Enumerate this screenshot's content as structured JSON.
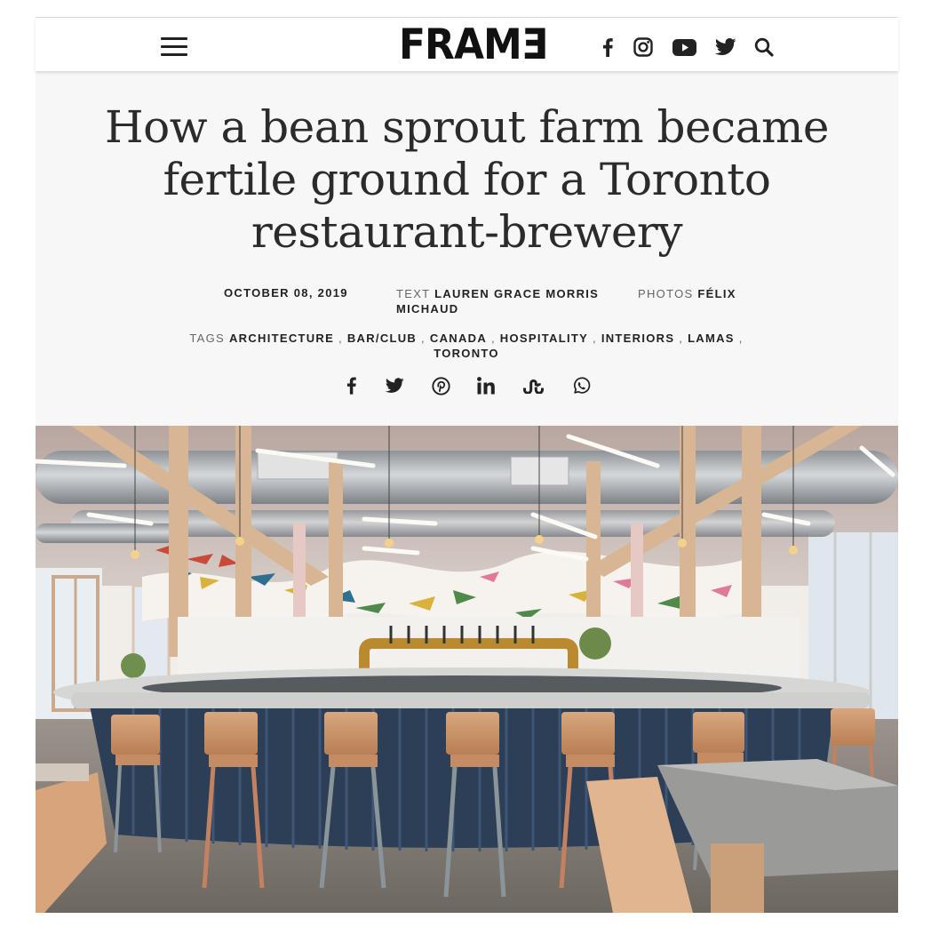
{
  "header": {
    "logo": "FRAMƎ",
    "menu_icon": "hamburger-menu-icon",
    "social_icons": [
      "facebook-icon",
      "instagram-icon",
      "youtube-icon",
      "twitter-icon",
      "search-icon"
    ]
  },
  "article": {
    "title": "How a bean sprout farm became fertile ground for a Toronto restaurant-brewery",
    "date": "OCTOBER 08, 2019",
    "text_label": "TEXT",
    "author": "LAUREN GRACE MORRIS MICHAUD",
    "photos_label": "PHOTOS",
    "photographer": "FÉLIX",
    "tags_label": "TAGS",
    "tags": [
      "ARCHITECTURE",
      "BAR/CLUB",
      "CANADA",
      "HOSPITALITY",
      "INTERIORS",
      "LAMAS",
      "TORONTO"
    ],
    "tag_separator": ",",
    "share_icons": [
      "facebook-icon",
      "twitter-icon",
      "pinterest-icon",
      "linkedin-icon",
      "stumbleupon-icon",
      "whatsapp-icon"
    ]
  },
  "colors": {
    "hero_background": "#f7f7f7",
    "text": "#2b2b2b",
    "icon": "#222222"
  }
}
